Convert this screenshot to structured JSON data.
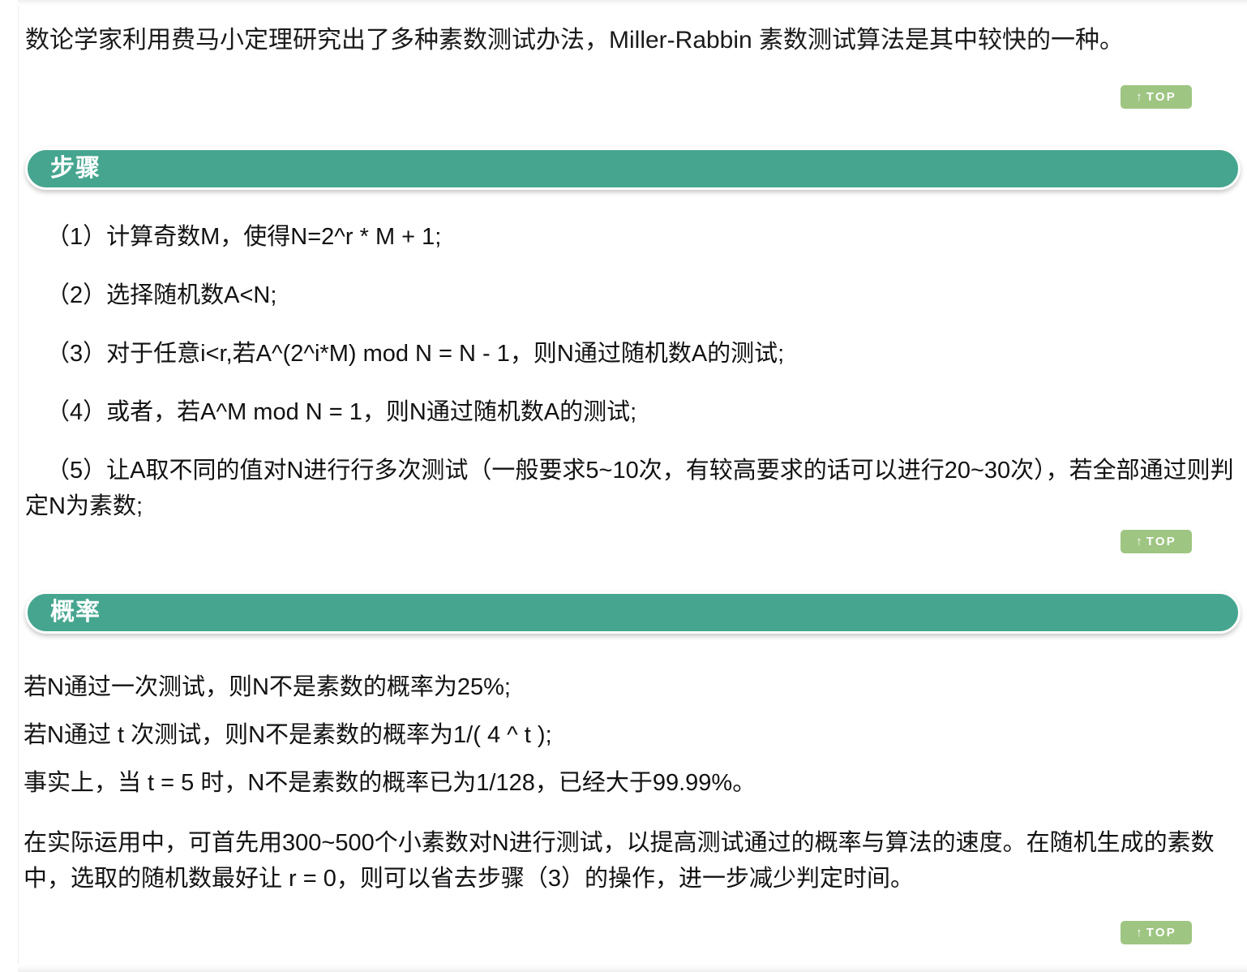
{
  "document": {
    "intro": "数论学家利用费马小定理研究出了多种素数测试办法，Miller-Rabbin 素数测试算法是其中较快的一种。",
    "sections": [
      {
        "title": "步骤",
        "steps": [
          "（1）计算奇数M，使得N=2^r * M + 1;",
          "（2）选择随机数A<N;",
          "（3）对于任意i<r,若A^(2^i*M) mod N = N - 1，则N通过随机数A的测试;",
          "（4）或者，若A^M mod N = 1，则N通过随机数A的测试;",
          "（5）让A取不同的值对N进行行多次测试（一般要求5~10次，有较高要求的话可以进行20~30次），若全部通过则判定N为素数;"
        ]
      },
      {
        "title": "概率",
        "paragraphs": [
          "若N通过一次测试，则N不是素数的概率为25%;",
          "若N通过 t 次测试，则N不是素数的概率为1/( 4 ^ t );",
          "事实上，当 t = 5 时，N不是素数的概率已为1/128，已经大于99.99%。",
          "在实际运用中，可首先用300~500个小素数对N进行测试，以提高测试通过的概率与算法的速度。在随机生成的素数中，选取的随机数最好让 r = 0，则可以省去步骤（3）的操作，进一步减少判定时间。"
        ]
      }
    ],
    "top_button": {
      "arrow_icon": "up-arrow-icon",
      "arrow_glyph": "↑",
      "label": "TOP"
    },
    "colors": {
      "section_bar": "#46a58f",
      "top_button": "#9ec582",
      "text": "#121212",
      "page_background": "#ffffff"
    }
  }
}
